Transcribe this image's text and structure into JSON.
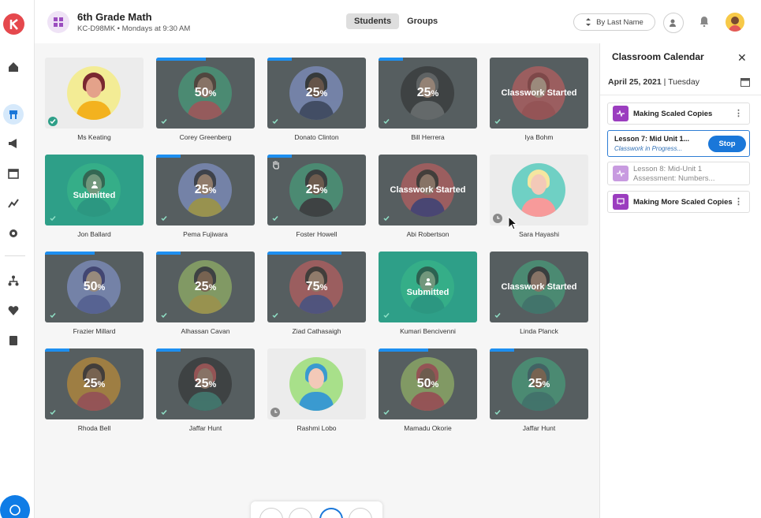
{
  "colors": {
    "accent": "#1a77d9",
    "brand": "#e5484d",
    "submitted": "#2e9f88",
    "dimmed": "#565e60"
  },
  "header": {
    "class_title": "6th Grade Math",
    "class_sub": "KC-D98MK • Mondays at 9:30 AM",
    "tabs": [
      {
        "label": "Students",
        "active": true
      },
      {
        "label": "Groups",
        "active": false
      }
    ],
    "sort_label": "By Last Name"
  },
  "nav": [
    "home-icon",
    "classroom-icon",
    "megaphone-icon",
    "calendar-icon",
    "trend-icon",
    "gear-icon",
    "network-icon",
    "heart-icon",
    "book-icon"
  ],
  "students": [
    {
      "name": "Ms Keating",
      "state": "plain",
      "progress": 0,
      "av": "#f3ec95",
      "hair": "#7a2830",
      "skin": "#e4a28a",
      "body": "#f3b21f",
      "check": true
    },
    {
      "name": "Corey Greenberg",
      "state": "pct",
      "pct": "50",
      "progress": 0.5,
      "av": "#3ec18a",
      "hair": "#4a2a1a",
      "skin": "#c48f6f",
      "body": "#e35858",
      "check": true
    },
    {
      "name": "Donato Clinton",
      "state": "pct",
      "pct": "25",
      "progress": 0.25,
      "av": "#9ab0ff",
      "hair": "#111",
      "skin": "#7a4b30",
      "body": "#2a3a6a",
      "check": true
    },
    {
      "name": "Bill Herrera",
      "state": "pct",
      "pct": "25",
      "progress": 0.25,
      "av": "#222",
      "hair": "#6a6a6a",
      "skin": "#e0b090",
      "body": "#777",
      "check": true
    },
    {
      "name": "Iya Bohm",
      "state": "text",
      "text": "Classwork Started",
      "progress": 0,
      "av": "#f06060",
      "hair": "#b03030",
      "skin": "#f0c0a0",
      "body": "#e04a4a",
      "check": true
    },
    {
      "name": "Jon Ballard",
      "state": "submitted",
      "text": "Submitted",
      "progress": 0,
      "av": "#3ec18a",
      "hair": "#3a2416",
      "skin": "#c48f6f",
      "body": "#2a8f7a",
      "check": true
    },
    {
      "name": "Pema Fujiwara",
      "state": "pct",
      "pct": "25",
      "progress": 0.25,
      "av": "#9ab0ff",
      "hair": "#223",
      "skin": "#d7a07a",
      "body": "#e8d23c",
      "check": true
    },
    {
      "name": "Foster Howell",
      "state": "pct",
      "pct": "25",
      "progress": 0.25,
      "av": "#3ec18a",
      "hair": "#1a1a1a",
      "skin": "#8a5a3a",
      "body": "#222",
      "check": true,
      "hand": true
    },
    {
      "name": "Abi Robertson",
      "state": "text",
      "text": "Classwork Started",
      "progress": 0,
      "av": "#f06060",
      "hair": "#2a1a10",
      "skin": "#c48f6f",
      "body": "#3a2a8a",
      "check": true
    },
    {
      "name": "Sara Hayashi",
      "state": "plain",
      "progress": 0,
      "av": "#6fd0c4",
      "hair": "#f5e6a0",
      "skin": "#f3c9b8",
      "body": "#f79a9a",
      "clock": true
    },
    {
      "name": "Frazier Millard",
      "state": "pct",
      "pct": "50",
      "progress": 0.5,
      "av": "#9ab0ff",
      "hair": "#2a2a8a",
      "skin": "#e8c0a0",
      "body": "#5a6ad0",
      "check": true
    },
    {
      "name": "Alhassan Cavan",
      "state": "pct",
      "pct": "25",
      "progress": 0.25,
      "av": "#b6e36a",
      "hair": "#222",
      "skin": "#a06a40",
      "body": "#e8d23c",
      "check": true
    },
    {
      "name": "Ziad Cathasaigh",
      "state": "pct",
      "pct": "75",
      "progress": 0.75,
      "av": "#f06060",
      "hair": "#2a1a10",
      "skin": "#d7a07a",
      "body": "#4a4aa0",
      "check": true
    },
    {
      "name": "Kumari Bencivenni",
      "state": "submitted",
      "text": "Submitted",
      "progress": 0,
      "av": "#3ec18a",
      "hair": "#2a1a10",
      "skin": "#c48f6f",
      "body": "#2a8f7a",
      "check": true
    },
    {
      "name": "Linda Planck",
      "state": "text",
      "text": "Classwork Started",
      "progress": 0,
      "av": "#3ec18a",
      "hair": "#1a1a1a",
      "skin": "#c48f6f",
      "body": "#2a8f7a",
      "check": true
    },
    {
      "name": "Rhoda Bell",
      "state": "pct",
      "pct": "25",
      "progress": 0.25,
      "av": "#f5a623",
      "hair": "#2a1a10",
      "skin": "#a06a40",
      "body": "#e04a4a",
      "check": true
    },
    {
      "name": "Jaffar Hunt",
      "state": "pct",
      "pct": "25",
      "progress": 0.25,
      "av": "#222",
      "hair": "#e04a4a",
      "skin": "#c48f6f",
      "body": "#2a8f7a",
      "check": true
    },
    {
      "name": "Rashmi Lobo",
      "state": "plain",
      "progress": 0,
      "av": "#a8e08a",
      "hair": "#3a9ad0",
      "skin": "#f3c9b8",
      "body": "#3a9ad0",
      "clock": true
    },
    {
      "name": "Mamadu Okorie",
      "state": "pct",
      "pct": "50",
      "progress": 0.5,
      "av": "#b6e36a",
      "hair": "#e04a4a",
      "skin": "#8a5a3a",
      "body": "#e04a4a",
      "check": true
    },
    {
      "name": "Jaffar Hunt",
      "state": "pct",
      "pct": "25",
      "progress": 0.25,
      "av": "#3ec18a",
      "hair": "#2a6a6a",
      "skin": "#a06a40",
      "body": "#2a8f7a",
      "check": true
    }
  ],
  "calendar": {
    "title": "Classroom Calendar",
    "date": "April 25, 2021",
    "weekday": "Tuesday",
    "items": [
      {
        "label": "Making Scaled Copies"
      },
      {
        "title": "Lesson 7: Mid Unit 1...",
        "status": "Classwork in Progress...",
        "button": "Stop"
      },
      {
        "label": "Lesson 8: Mid-Unit 1 Assessment: Numbers..."
      },
      {
        "label": "Making More Scaled Copies"
      }
    ]
  }
}
